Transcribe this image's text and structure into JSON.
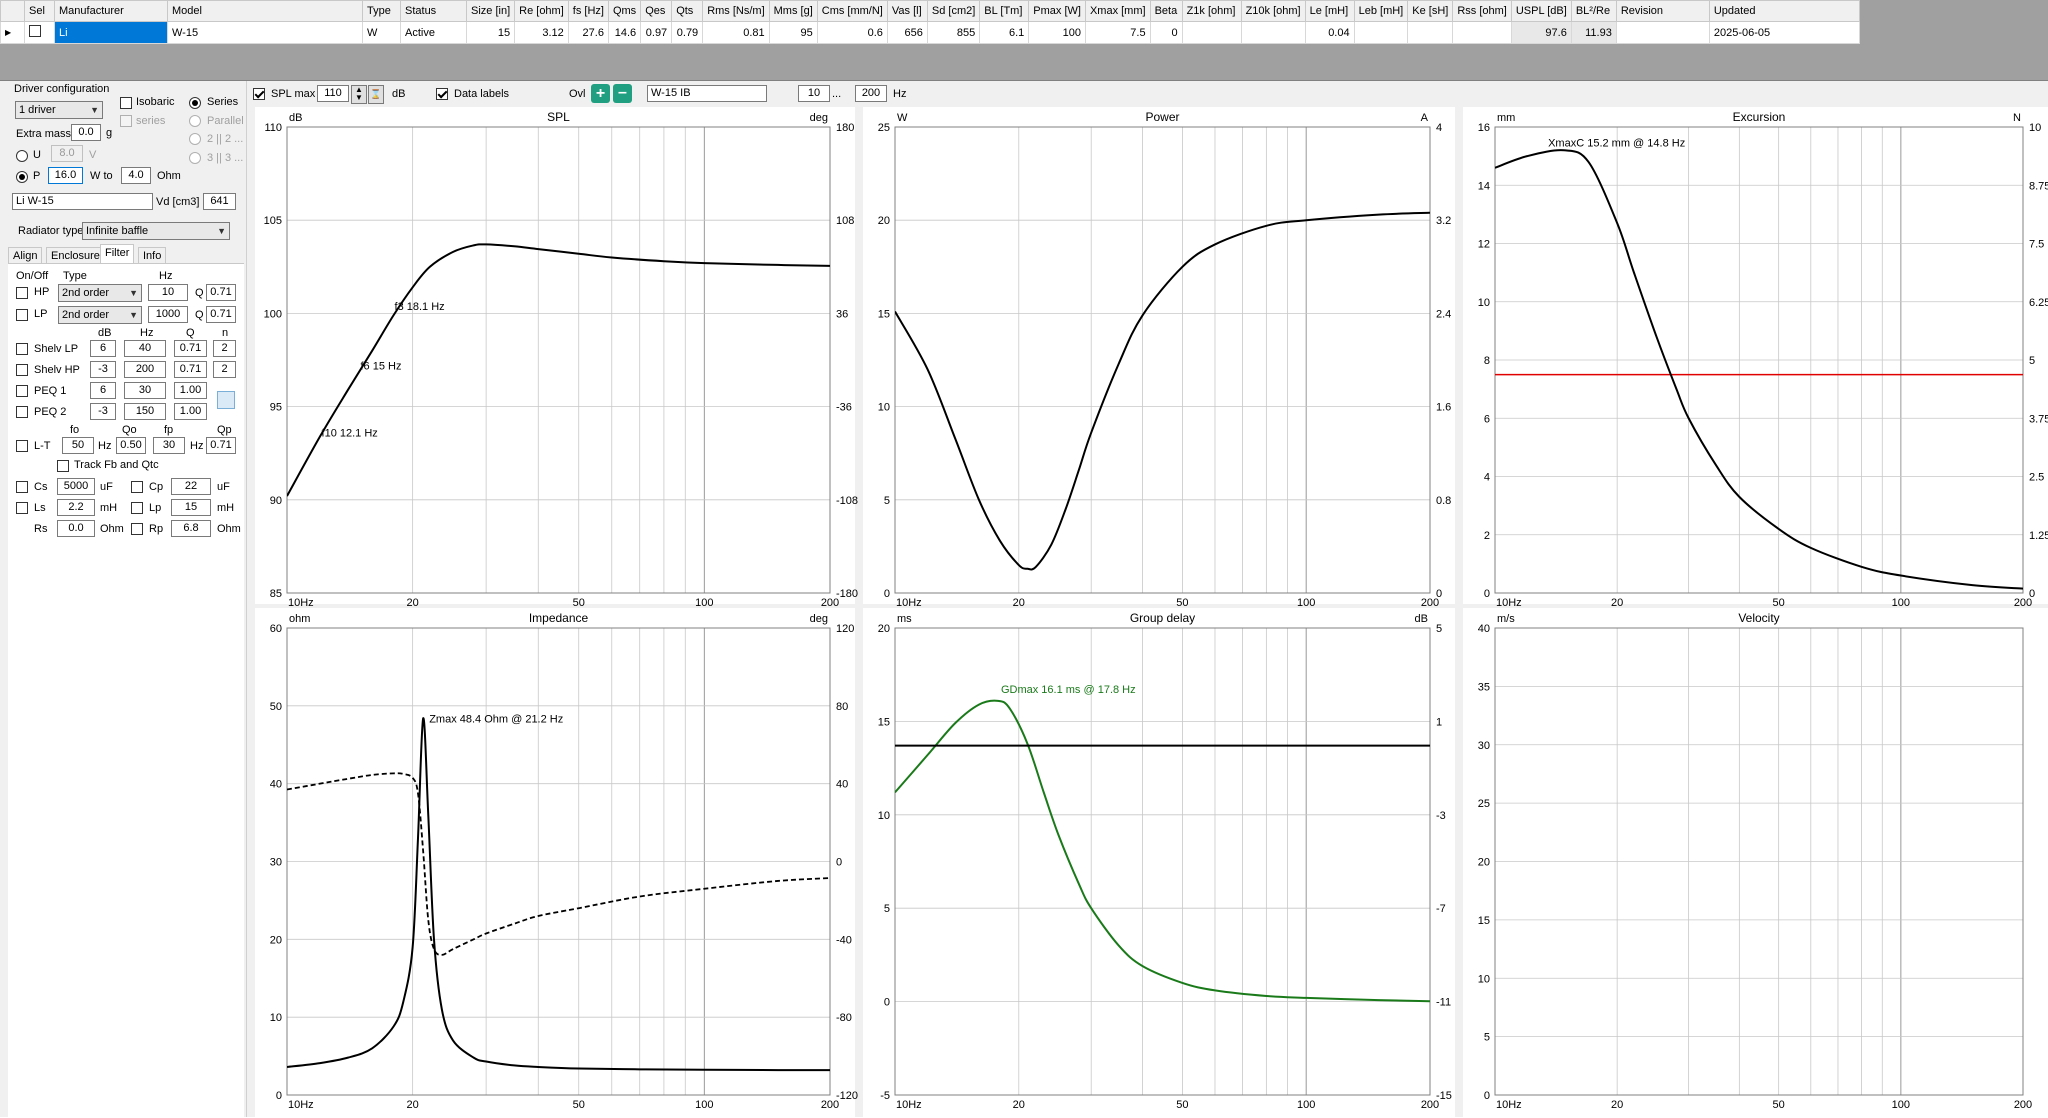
{
  "grid": {
    "columns": [
      "Sel",
      "Manufacturer",
      "Model",
      "Type",
      "Status",
      "Size [in]",
      "Re [ohm]",
      "fs [Hz]",
      "Qms",
      "Qes",
      "Qts",
      "Rms [Ns/m]",
      "Mms [g]",
      "Cms [mm/N]",
      "Vas [l]",
      "Sd [cm2]",
      "BL [Tm]",
      "Pmax [W]",
      "Xmax [mm]",
      "Beta",
      "Z1k [ohm]",
      "Z10k [ohm]",
      "Le [mH]",
      "Leb [mH]",
      "Ke [sH]",
      "Rss [ohm]",
      "USPL [dB]",
      "BL²/Re",
      "Revision",
      "Updated"
    ],
    "row": [
      "",
      "Li",
      "W-15",
      "W",
      "Active",
      "15",
      "3.12",
      "27.6",
      "14.6",
      "0.97",
      "0.79",
      "0.81",
      "95",
      "0.6",
      "656",
      "855",
      "6.1",
      "100",
      "7.5",
      "0",
      "",
      "",
      "0.04",
      "",
      "",
      "",
      "97.6",
      "11.93",
      "",
      "2025-06-05"
    ]
  },
  "left": {
    "driver_config_label": "Driver configuration",
    "drivers_value": "1 driver",
    "isobaric_label": "Isobaric",
    "series_label": "Series",
    "series_sub_label": "series",
    "parallel_label": "Parallel",
    "opt_2": "2 || 2 ...",
    "opt_3": "3 || 3 ...",
    "extra_mass_label": "Extra mass",
    "extra_mass_value": "0.0",
    "extra_mass_unit": "g",
    "u_label": "U",
    "u_value": "8.0",
    "u_unit": "V",
    "p_label": "P",
    "p_value": "16.0",
    "w_to_label": "W to",
    "w_to_value": "4.0",
    "ohm_label": "Ohm",
    "name_value": "Li W-15",
    "vd_label": "Vd [cm3]",
    "vd_value": "641",
    "radiator_label": "Radiator type",
    "radiator_value": "Infinite baffle",
    "tabs": [
      "Align",
      "Enclosure",
      "Filter",
      "Info"
    ],
    "hdr_onoff": "On/Off",
    "hdr_type": "Type",
    "hdr_hz": "Hz",
    "hp_label": "HP",
    "hp_type": "2nd order",
    "hp_hz": "10",
    "hp_q_label": "Q",
    "hp_q": "0.71",
    "lp_label": "LP",
    "lp_type": "2nd order",
    "lp_hz": "1000",
    "lp_q": "0.71",
    "hdr_db": "dB",
    "hdr_hz2": "Hz",
    "hdr_q": "Q",
    "hdr_n": "n",
    "shelv_lp_label": "Shelv LP",
    "shelv_lp": [
      "6",
      "40",
      "0.71",
      "2"
    ],
    "shelv_hp_label": "Shelv HP",
    "shelv_hp": [
      "-3",
      "200",
      "0.71",
      "2"
    ],
    "peq1_label": "PEQ 1",
    "peq1": [
      "6",
      "30",
      "1.00"
    ],
    "peq2_label": "PEQ 2",
    "peq2": [
      "-3",
      "150",
      "1.00"
    ],
    "hdr_fo": "fo",
    "hdr_qo": "Qo",
    "hdr_fp": "fp",
    "hdr_qp": "Qp",
    "lt_label": "L-T",
    "lt": [
      "50",
      "0.50",
      "30",
      "0.71"
    ],
    "lt_hz": "Hz",
    "track_label": "Track Fb and Qtc",
    "cs_label": "Cs",
    "cs_value": "5000",
    "cs_unit": "uF",
    "cp_label": "Cp",
    "cp_value": "22",
    "cp_unit": "uF",
    "ls_label": "Ls",
    "ls_value": "2.2",
    "ls_unit": "mH",
    "lp2_label": "Lp",
    "lp2_value": "15",
    "lp2_unit": "mH",
    "rs_label": "Rs",
    "rs_value": "0.0",
    "rs_unit": "Ohm",
    "rp_label": "Rp",
    "rp_value": "6.8",
    "rp_unit": "Ohm"
  },
  "toolbar": {
    "splmax_label": "SPL max",
    "splmax_value": "110",
    "db_label": "dB",
    "datalabels_label": "Data labels",
    "ovl_label": "Ovl",
    "ovl_name": "W-15 IB",
    "fmin": "10",
    "dots": "...",
    "fmax": "200",
    "hz": "Hz"
  },
  "colors": {
    "curve": "#000000",
    "xmax_line": "#e00000",
    "gd_curve": "#1a7a1a",
    "grid": "#c8c8c8",
    "grid_major": "#a0a0a0"
  },
  "chart_data": [
    {
      "type": "line",
      "title": "SPL",
      "xscale": "log",
      "xlim": [
        10,
        200
      ],
      "x_ticks": [
        "10Hz",
        "20",
        "50",
        "100",
        "200"
      ],
      "left_unit": "dB",
      "ylim": [
        85,
        110
      ],
      "y_ticks": [
        "110",
        "105",
        "100",
        "95",
        "90",
        "85"
      ],
      "right_unit": "deg",
      "y2_ticks": [
        "180",
        "108",
        "36",
        "-36",
        "-108",
        "-180"
      ],
      "series": [
        {
          "x": [
            10,
            12,
            14,
            16,
            18,
            20,
            22,
            25,
            28,
            30,
            35,
            40,
            50,
            60,
            80,
            100,
            150,
            200
          ],
          "y": [
            90.2,
            93.4,
            95.9,
            98.0,
            99.9,
            101.4,
            102.5,
            103.3,
            103.65,
            103.7,
            103.6,
            103.45,
            103.2,
            103.0,
            102.8,
            102.7,
            102.6,
            102.55
          ]
        }
      ],
      "annotations": [
        {
          "text": "f3 18.1 Hz",
          "x": 18.1,
          "y": 100.4
        },
        {
          "text": "f6 15 Hz",
          "x": 15,
          "y": 97.2
        },
        {
          "text": "f10 12.1 Hz",
          "x": 12.1,
          "y": 93.6
        }
      ]
    },
    {
      "type": "line",
      "title": "Power",
      "xscale": "log",
      "xlim": [
        10,
        200
      ],
      "x_ticks": [
        "10Hz",
        "20",
        "50",
        "100",
        "200"
      ],
      "left_unit": "W",
      "ylim": [
        0,
        25
      ],
      "y_ticks": [
        "25",
        "20",
        "15",
        "10",
        "5",
        "0"
      ],
      "right_unit": "A",
      "y2_ticks": [
        "4",
        "3.2",
        "2.4",
        "1.6",
        "0.8",
        "0"
      ],
      "series": [
        {
          "x": [
            10,
            12,
            14,
            16,
            18,
            20,
            21,
            22,
            24,
            26,
            28,
            30,
            35,
            40,
            50,
            60,
            80,
            100,
            150,
            200
          ],
          "y": [
            15.1,
            12.0,
            8.3,
            5.0,
            2.8,
            1.5,
            1.3,
            1.4,
            2.6,
            4.5,
            6.6,
            8.6,
            12.3,
            14.9,
            17.5,
            18.7,
            19.7,
            20.0,
            20.3,
            20.4
          ]
        }
      ]
    },
    {
      "type": "line",
      "title": "Excursion",
      "xscale": "log",
      "xlim": [
        10,
        200
      ],
      "x_ticks": [
        "10Hz",
        "20",
        "50",
        "100",
        "200"
      ],
      "left_unit": "mm",
      "ylim": [
        0,
        16
      ],
      "y_ticks": [
        "16",
        "14",
        "12",
        "10",
        "8",
        "6",
        "4",
        "2",
        "0"
      ],
      "right_unit": "N",
      "y2_ticks": [
        "10",
        "8.75",
        "7.5",
        "6.25",
        "5",
        "3.75",
        "2.5",
        "1.25",
        "0"
      ],
      "xmax_line": 7.5,
      "series": [
        {
          "x": [
            10,
            12,
            14.8,
            17,
            20,
            22,
            25,
            28,
            30,
            35,
            40,
            50,
            60,
            80,
            100,
            150,
            200
          ],
          "y": [
            14.6,
            15.0,
            15.2,
            14.8,
            12.7,
            11.0,
            8.8,
            7.0,
            6.0,
            4.4,
            3.3,
            2.2,
            1.55,
            0.9,
            0.6,
            0.27,
            0.15
          ]
        }
      ],
      "annotations": [
        {
          "text": "XmaxC 15.2 mm  @ 14.8 Hz",
          "x": 14.8,
          "y": 15.2
        }
      ]
    },
    {
      "type": "line",
      "title": "Impedance",
      "xscale": "log",
      "xlim": [
        10,
        200
      ],
      "x_ticks": [
        "10Hz",
        "20",
        "50",
        "100",
        "200"
      ],
      "left_unit": "ohm",
      "ylim": [
        0,
        60
      ],
      "y_ticks": [
        "60",
        "50",
        "40",
        "30",
        "20",
        "10",
        "0"
      ],
      "right_unit": "deg",
      "y2_ticks": [
        "120",
        "80",
        "40",
        "0",
        "-40",
        "-80",
        "-120"
      ],
      "series": [
        {
          "name": "magnitude",
          "x": [
            10,
            12,
            14,
            16,
            18,
            19,
            20,
            20.6,
            21.2,
            21.8,
            22.5,
            23.5,
            25,
            28,
            30,
            35,
            40,
            50,
            70,
            100,
            150,
            200
          ],
          "y": [
            3.6,
            4.1,
            4.8,
            6.0,
            8.8,
            12.0,
            19.0,
            33.0,
            48.4,
            36.0,
            20.0,
            11.0,
            7.0,
            4.8,
            4.3,
            3.8,
            3.6,
            3.4,
            3.3,
            3.25,
            3.2,
            3.2
          ]
        },
        {
          "name": "phase",
          "x": [
            10,
            12,
            14,
            16,
            18,
            19,
            20,
            20.6,
            21.2,
            21.8,
            22.5,
            23.5,
            25,
            28,
            30,
            35,
            40,
            50,
            70,
            100,
            150,
            200
          ],
          "y": [
            37,
            40,
            42.5,
            44.5,
            45.3,
            45.0,
            43.0,
            35.0,
            5.0,
            -30.0,
            -45.0,
            -48.0,
            -45.0,
            -40.0,
            -37.0,
            -32.0,
            -28.0,
            -24.0,
            -18.0,
            -14.0,
            -10.0,
            -8.5
          ]
        }
      ],
      "annotations": [
        {
          "text": "Zmax 48.4 Ohm @ 21.2 Hz",
          "x": 21.2,
          "y": 48.4
        }
      ]
    },
    {
      "type": "line",
      "title": "Group delay",
      "xscale": "log",
      "xlim": [
        10,
        200
      ],
      "x_ticks": [
        "10Hz",
        "20",
        "50",
        "100",
        "200"
      ],
      "left_unit": "ms",
      "ylim": [
        -5,
        20
      ],
      "y_ticks": [
        "20",
        "15",
        "10",
        "5",
        "0",
        "-5"
      ],
      "right_unit": "dB",
      "y2_ticks": [
        "5",
        "1",
        "-3",
        "-7",
        "-11",
        "-15"
      ],
      "series": [
        {
          "name": "group delay",
          "x": [
            10,
            12,
            14,
            16,
            17.8,
            19,
            21,
            23,
            25,
            28,
            30,
            35,
            40,
            50,
            60,
            80,
            100,
            150,
            200
          ],
          "y": [
            11.2,
            13.2,
            14.9,
            15.9,
            16.1,
            15.7,
            13.8,
            11.2,
            8.9,
            6.3,
            5.0,
            3.0,
            1.9,
            1.0,
            0.6,
            0.3,
            0.2,
            0.08,
            0.02
          ]
        },
        {
          "name": "level",
          "x": [
            10,
            200
          ],
          "y": [
            13.7,
            13.7
          ]
        }
      ],
      "annotations": [
        {
          "text": "GDmax 16.1 ms  @ 17.8 Hz",
          "x": 17.8,
          "y": 16.1
        }
      ]
    },
    {
      "type": "line",
      "title": "Velocity",
      "xscale": "log",
      "xlim": [
        10,
        200
      ],
      "x_ticks": [
        "10Hz",
        "20",
        "50",
        "100",
        "200"
      ],
      "left_unit": "m/s",
      "ylim": [
        0,
        40
      ],
      "y_ticks": [
        "40",
        "35",
        "30",
        "25",
        "20",
        "15",
        "10",
        "5",
        "0"
      ],
      "series": []
    }
  ]
}
